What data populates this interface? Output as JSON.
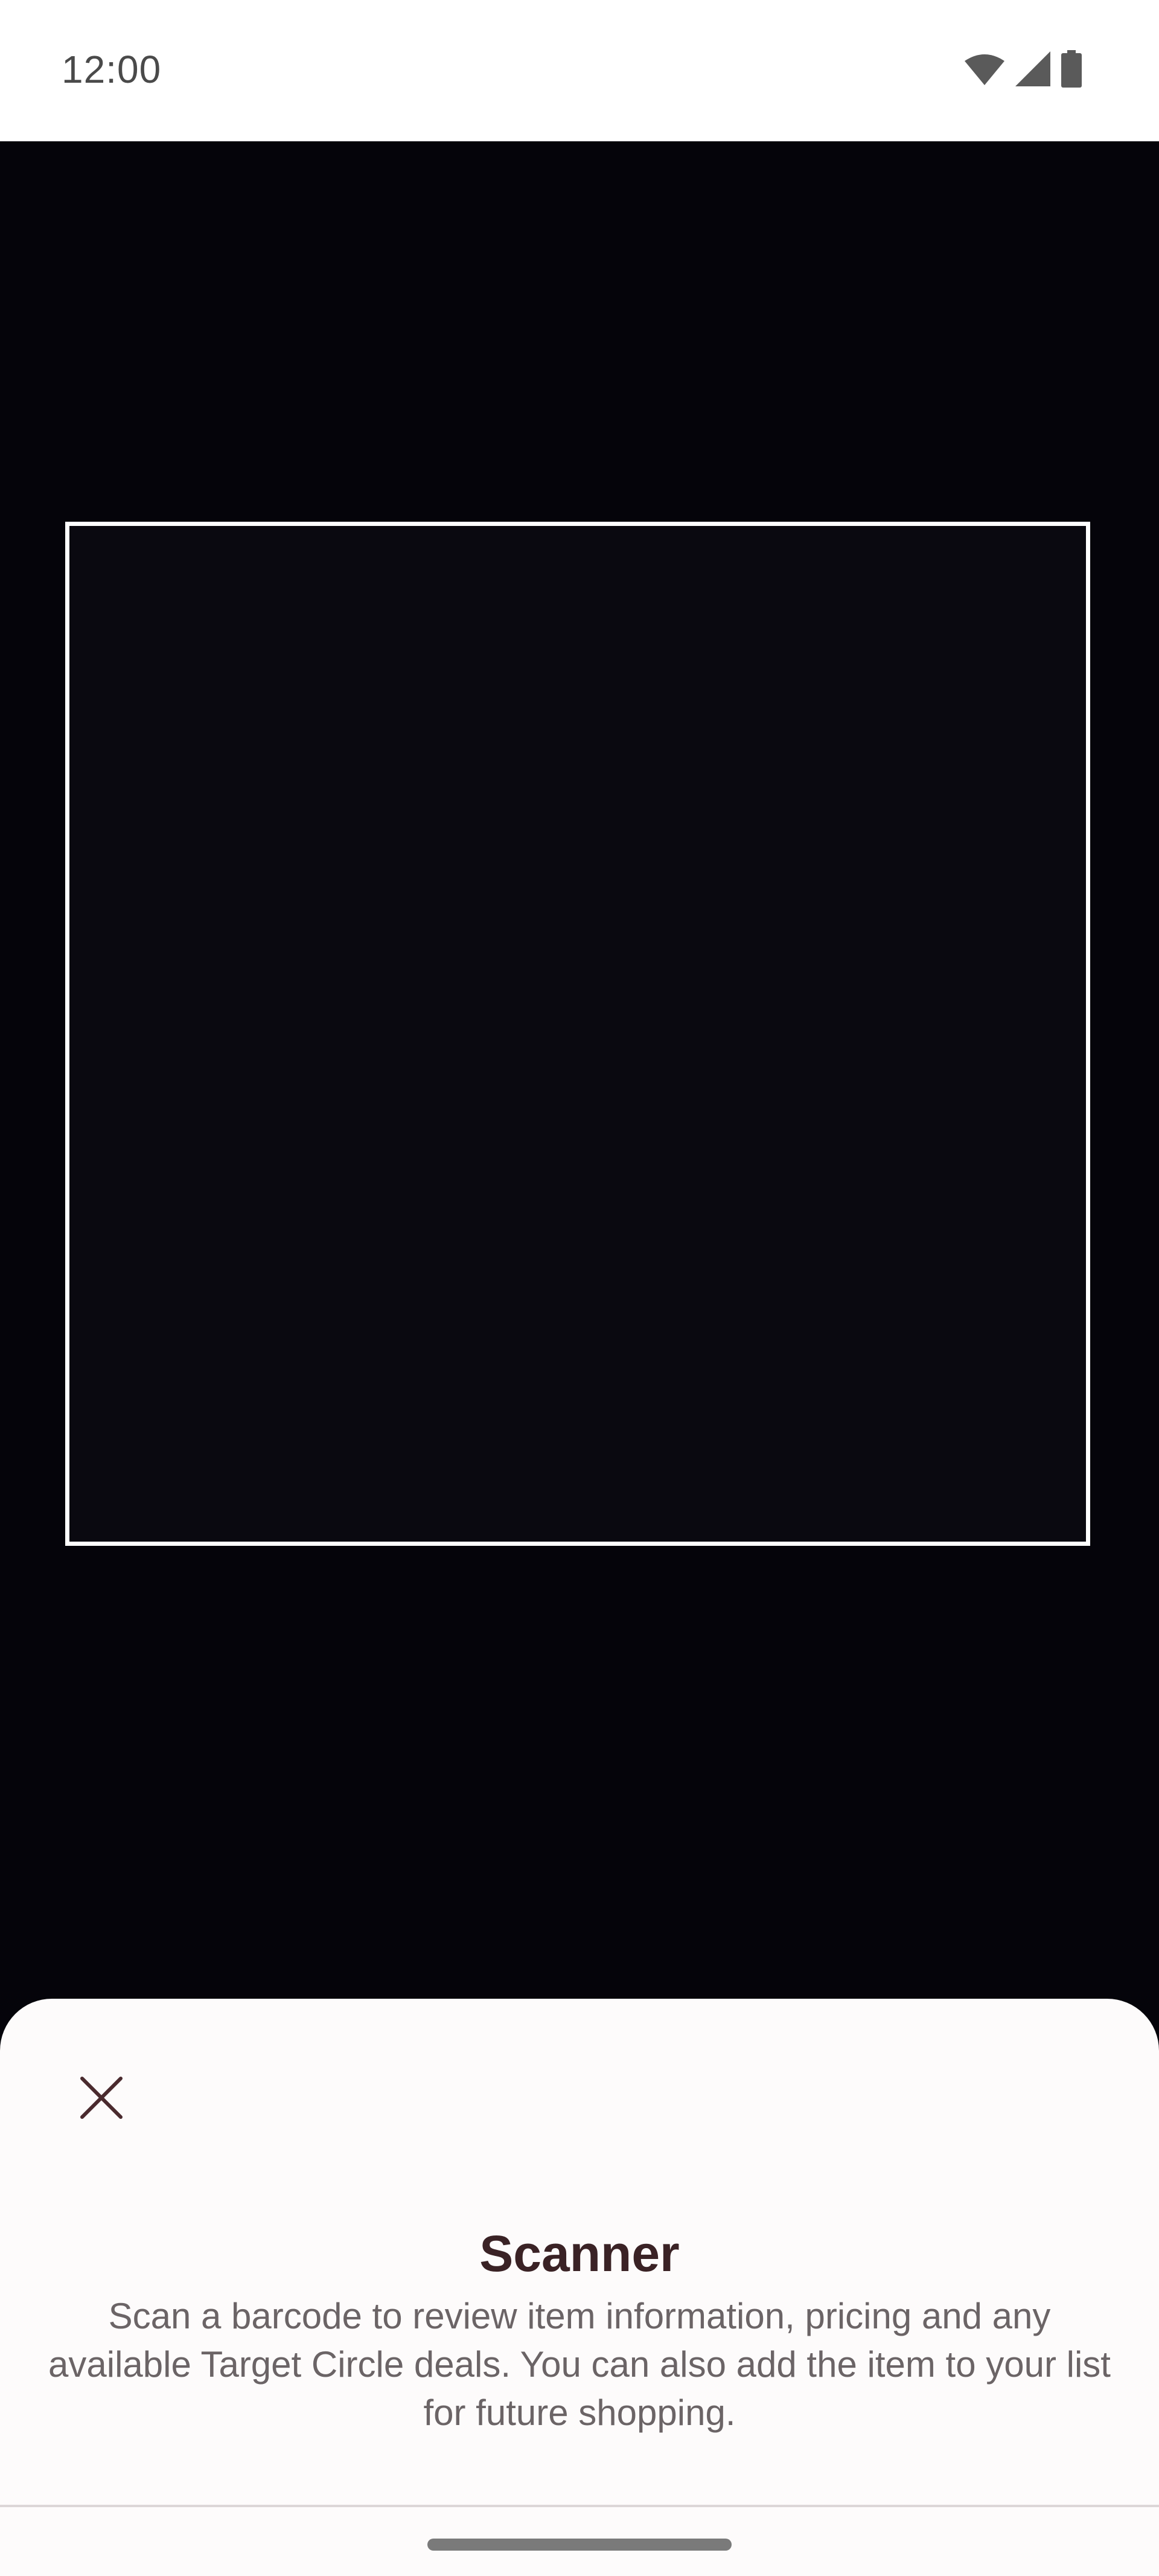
{
  "status_bar": {
    "time": "12:00",
    "icons": [
      "wifi-icon",
      "cellular-signal-icon",
      "battery-icon"
    ]
  },
  "camera": {
    "frame_color": "#ffffff",
    "background_color": "#05040a"
  },
  "sheet": {
    "close_icon": "close-icon",
    "title": "Scanner",
    "description": "Scan a barcode to review item information, pricing and any available Target Circle deals. You can also add the item to your list for future shopping.",
    "title_color": "#3a2225",
    "text_color": "#6b6466"
  }
}
